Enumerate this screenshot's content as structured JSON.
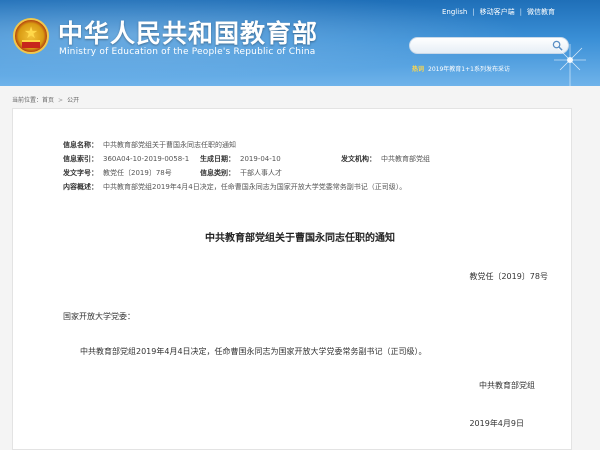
{
  "header": {
    "title": "中华人民共和国教育部",
    "subtitle": "Ministry of Education of the People's Republic of China",
    "links": [
      "English",
      "移动客户端",
      "微信教育"
    ],
    "search_placeholder": "",
    "hot_label": "热词",
    "hot_text": "2019年教育1+1系列发布采访"
  },
  "breadcrumb": {
    "label": "当前位置：",
    "items": [
      "首页",
      "公开"
    ]
  },
  "meta": {
    "name_key": "信息名称：",
    "name_val": "中共教育部党组关于曹国永同志任职的通知",
    "index_key": "信息索引：",
    "index_val": "360A04-10-2019-0058-1",
    "date_key": "生成日期：",
    "date_val": "2019-04-10",
    "org_key": "发文机构：",
    "org_val": "中共教育部党组",
    "docnum_key": "发文字号：",
    "docnum_val": "教党任〔2019〕78号",
    "category_key": "信息类别：",
    "category_val": "干部人事人才",
    "summary_key": "内容概述：",
    "summary_val": "中共教育部党组2019年4月4日决定，任命曹国永同志为国家开放大学党委常务副书记（正司级）。"
  },
  "document": {
    "title": "中共教育部党组关于曹国永同志任职的通知",
    "number": "教党任〔2019〕78号",
    "addressee": "国家开放大学党委：",
    "body": "中共教育部党组2019年4月4日决定，任命曹国永同志为国家开放大学党委常务副书记（正司级）。",
    "signature": "中共教育部党组",
    "date": "2019年4月9日"
  }
}
